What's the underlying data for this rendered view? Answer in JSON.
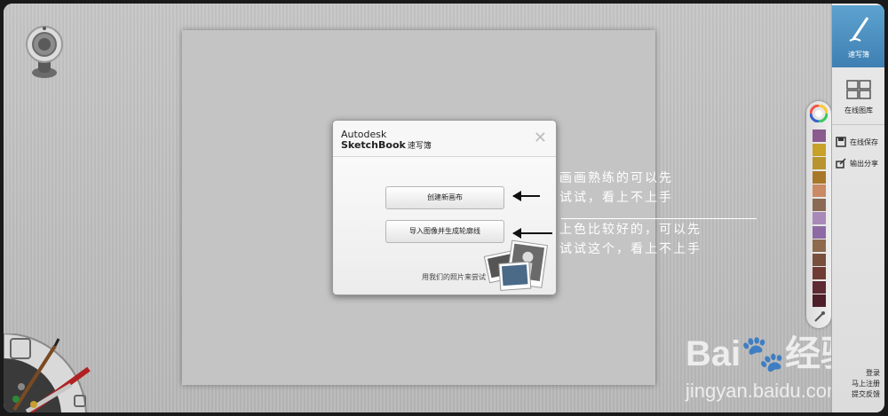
{
  "right_panel": {
    "sketch_tab": "速写簿",
    "gallery_tab": "在线图库",
    "save_online": "在线保存",
    "export_share": "输出分享",
    "links": [
      "登录",
      "马上注册",
      "提交反馈"
    ]
  },
  "palette": {
    "colors": [
      "#8b5a8f",
      "#c7a12a",
      "#b8942e",
      "#a8782a",
      "#c98a64",
      "#8a6a54",
      "#a889b8",
      "#8d6aa4",
      "#8d6a4c",
      "#78503c",
      "#6e3c34",
      "#5e2a34",
      "#4e1e2a"
    ]
  },
  "dialog": {
    "brand_line1": "Autodesk",
    "brand_line2": "SketchBook",
    "brand_suffix": "速写簿",
    "close": "✕",
    "create_canvas": "创建新画布",
    "import_image": "导入图像并生成轮廓线",
    "hint": "用我们的照片来尝试"
  },
  "annotations": {
    "note1_line1": "画画熟练的可以先",
    "note1_line2": "试试，看上不上手",
    "note2_line1": "上色比较好的，可以先",
    "note2_line2": "试试这个，看上不上手"
  },
  "watermark": {
    "brand": "Bai",
    "brand_tail": "经验",
    "url": "jingyan.baidu.com"
  }
}
